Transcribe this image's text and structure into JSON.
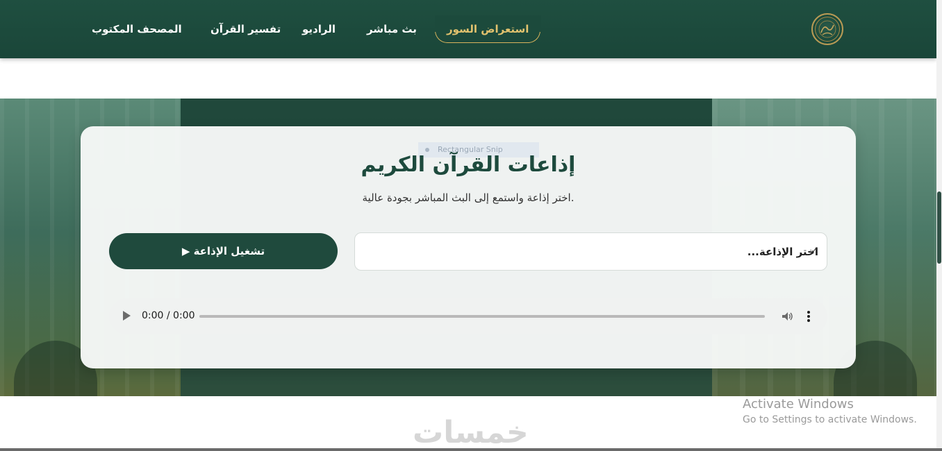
{
  "header": {
    "nav": [
      {
        "label": "استعراض السور",
        "active": true
      },
      {
        "label": "بث مباشر",
        "active": false
      },
      {
        "label": "الراديو",
        "active": false
      },
      {
        "label": "تفسير القرآن",
        "active": false
      },
      {
        "label": "المصحف المكتوب",
        "active": false
      }
    ],
    "logo_icon": "quran-calligraphy-logo"
  },
  "card": {
    "title": "إذاعات القرآن الكريم",
    "subtitle": "اختر إذاعة واستمع إلى البث المباشر بجودة عالية.",
    "select_placeholder": "اختر الإذاعة...",
    "play_button": "▶ تشغيل الإذاعة",
    "snip_label": "Rectangular Snip"
  },
  "audio": {
    "time": "0:00 / 0:00"
  },
  "footer": {
    "brand": "خمسات"
  },
  "os_overlay": {
    "activate_title": "Activate Windows",
    "activate_sub": "Go to Settings to activate Windows."
  },
  "colors": {
    "primary": "#1f4a3d",
    "accent_gold": "#e2c26e"
  }
}
